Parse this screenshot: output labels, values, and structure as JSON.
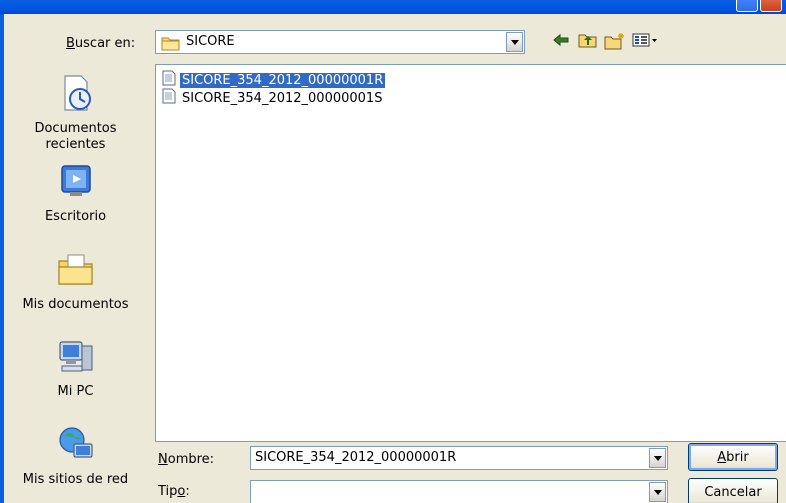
{
  "lookin": {
    "label_pre": "",
    "label_underlined": "B",
    "label_post": "uscar en:",
    "folder_value": "SICORE",
    "folder_icon": "folder-icon"
  },
  "toolbar": {
    "back_icon": "back-arrow-icon",
    "up_icon": "up-folder-icon",
    "new_folder_icon": "new-folder-icon",
    "view_menu_icon": "view-menu-icon"
  },
  "places": [
    {
      "label": "Documentos recientes",
      "icon": "recent-documents-icon"
    },
    {
      "label": "Escritorio",
      "icon": "desktop-icon"
    },
    {
      "label": "Mis documentos",
      "icon": "my-documents-icon"
    },
    {
      "label": "Mi PC",
      "icon": "my-computer-icon"
    },
    {
      "label": "Mis sitios de red",
      "icon": "network-places-icon"
    }
  ],
  "files": [
    {
      "name": "SICORE_354_2012_00000001R",
      "selected": true,
      "icon": "text-file-icon"
    },
    {
      "name": "SICORE_354_2012_00000001S",
      "selected": false,
      "icon": "text-file-icon"
    }
  ],
  "filename": {
    "label_underlined": "N",
    "label_post": "ombre:",
    "value": "SICORE_354_2012_00000001R"
  },
  "filetype": {
    "label_pre": "Tip",
    "label_underlined": "o",
    "label_post": ":",
    "value": ""
  },
  "buttons": {
    "open_underlined": "A",
    "open_post": "brir",
    "cancel": "Cancelar"
  },
  "colors": {
    "selection": "#316ac5",
    "dialog_bg": "#ece9d8",
    "field_border": "#7f9db9"
  }
}
